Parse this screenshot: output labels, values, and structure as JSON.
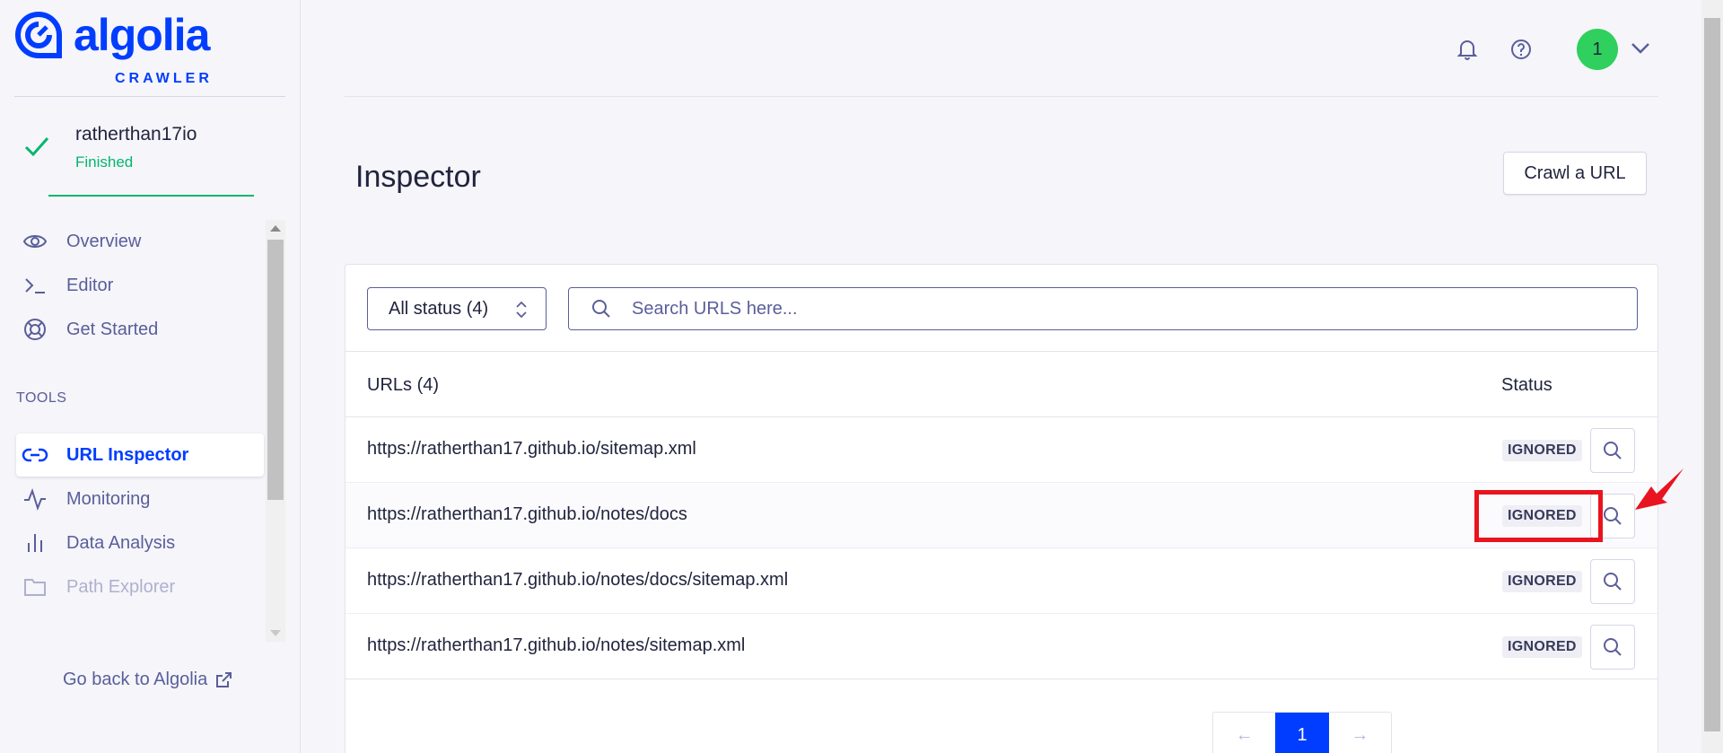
{
  "brand": {
    "name": "algolia",
    "product": "CRAWLER",
    "color": "#003dff"
  },
  "crawler": {
    "name": "ratherthan17io",
    "state": "Finished",
    "state_color": "#06b66c"
  },
  "nav": {
    "items": [
      {
        "label": "Overview",
        "icon": "eye-icon"
      },
      {
        "label": "Editor",
        "icon": "terminal-icon"
      },
      {
        "label": "Get Started",
        "icon": "lifebuoy-icon"
      }
    ],
    "tools_label": "TOOLS",
    "tools": [
      {
        "label": "URL Inspector",
        "icon": "link-icon",
        "active": true
      },
      {
        "label": "Monitoring",
        "icon": "activity-icon"
      },
      {
        "label": "Data Analysis",
        "icon": "bar-chart-icon"
      },
      {
        "label": "Path Explorer",
        "icon": "folder-icon"
      }
    ],
    "go_back": "Go back to Algolia"
  },
  "header": {
    "avatar_text": "1",
    "avatar_color": "#2fd05d"
  },
  "page": {
    "title": "Inspector",
    "crawl_button": "Crawl a URL"
  },
  "filters": {
    "status_select": "All status (4)",
    "search_placeholder": "Search URLS here..."
  },
  "table": {
    "col_urls": "URLs (4)",
    "col_status": "Status",
    "rows": [
      {
        "url": "https://ratherthan17.github.io/sitemap.xml",
        "status": "IGNORED"
      },
      {
        "url": "https://ratherthan17.github.io/notes/docs",
        "status": "IGNORED"
      },
      {
        "url": "https://ratherthan17.github.io/notes/docs/sitemap.xml",
        "status": "IGNORED"
      },
      {
        "url": "https://ratherthan17.github.io/notes/sitemap.xml",
        "status": "IGNORED"
      }
    ]
  },
  "pagination": {
    "prev": "←",
    "current": "1",
    "next": "→"
  },
  "annotation": {
    "highlight_color": "#e8141f"
  }
}
